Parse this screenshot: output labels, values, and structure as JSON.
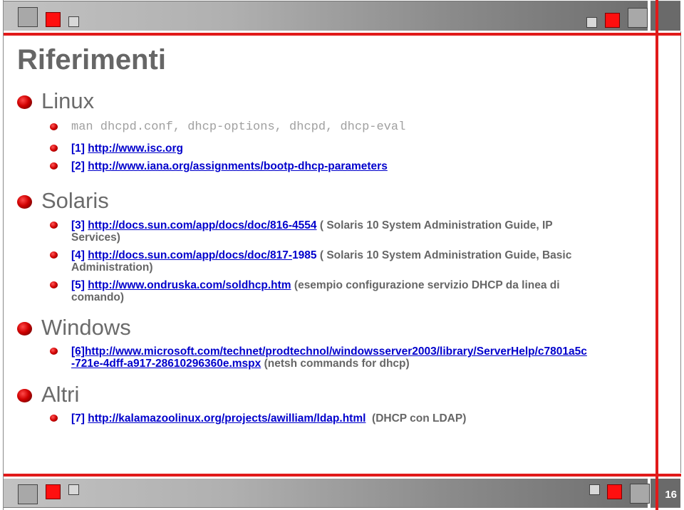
{
  "slide": {
    "title": "Riferimenti",
    "page_number": "16",
    "colors": {
      "accent_red": "#e11a1a",
      "link_blue": "#0000cc",
      "text_gray": "#666666"
    }
  },
  "sections": [
    {
      "title": "Linux",
      "items": [
        {
          "text": "man dhcpd.conf, dhcp-options, dhcpd, dhcp-eval"
        },
        {
          "ref": "[1]",
          "link": "http://www.isc.org"
        },
        {
          "ref": "[2]",
          "link": "http://www.iana.org/assignments/bootp-dhcp-parameters"
        }
      ]
    },
    {
      "title": "Solaris",
      "items": [
        {
          "ref": "[3]",
          "link": "http://docs.sun.com/app/docs/doc/816-4554",
          "desc_line1": "( Solaris 10 System Administration Guide, IP",
          "desc_line2": "Services)"
        },
        {
          "ref": "[4]",
          "link": "http://docs.sun.com/app/docs/doc/817-",
          "link_tail": "1985",
          "desc_line1": "( Solaris 10 System Administration Guide, Basic",
          "desc_line2": "Administration)"
        },
        {
          "ref": "[5]",
          "link": "http://www.ondruska.com/soldhcp.htm",
          "desc_line1": "(esempio configurazione servizio DHCP da linea di",
          "desc_line2": "comando)"
        }
      ]
    },
    {
      "title": "Windows",
      "items": [
        {
          "ref": "[6]",
          "link_line1": "http://www.microsoft.com/technet/prodtechnol/windowsserver2003/library/ServerHelp/c7801a5c",
          "link_line2": "-721e-4dff-a917-28610296360e.mspx",
          "desc": "(netsh commands for dhcp)"
        }
      ]
    },
    {
      "title": "Altri",
      "items": [
        {
          "ref": "[7]",
          "link": "http://kalamazoolinux.org/projects/awilliam/ldap.html",
          "desc": "(DHCP con LDAP)"
        }
      ]
    }
  ]
}
